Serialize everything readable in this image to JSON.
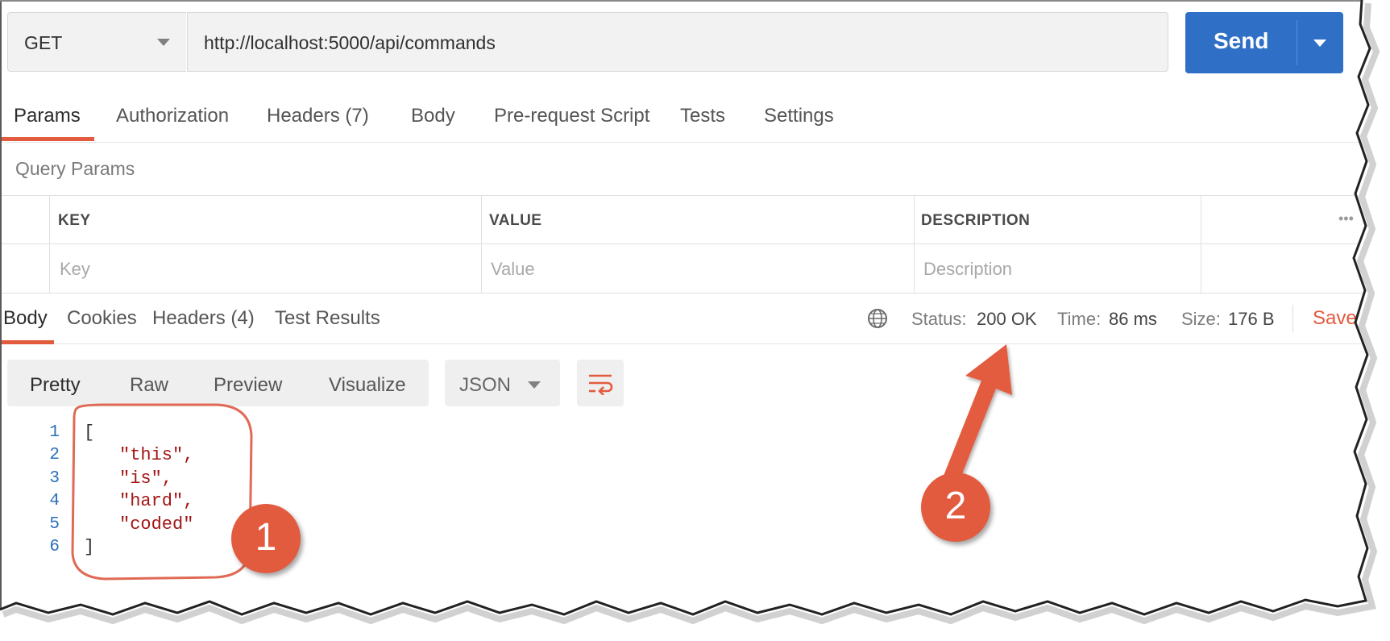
{
  "request": {
    "method": "GET",
    "url": "http://localhost:5000/api/commands",
    "send_label": "Send"
  },
  "request_tabs": [
    {
      "label": "Params",
      "active": true
    },
    {
      "label": "Authorization",
      "active": false
    },
    {
      "label": "Headers (7)",
      "active": false
    },
    {
      "label": "Body",
      "active": false
    },
    {
      "label": "Pre-request Script",
      "active": false
    },
    {
      "label": "Tests",
      "active": false
    },
    {
      "label": "Settings",
      "active": false
    }
  ],
  "query_params": {
    "title": "Query Params",
    "columns": [
      "KEY",
      "VALUE",
      "DESCRIPTION"
    ],
    "placeholders": {
      "key": "Key",
      "value": "Value",
      "description": "Description"
    }
  },
  "response_tabs": [
    {
      "label": "Body",
      "active": true
    },
    {
      "label": "Cookies",
      "active": false
    },
    {
      "label": "Headers (4)",
      "active": false
    },
    {
      "label": "Test Results",
      "active": false
    }
  ],
  "response_meta": {
    "status_label": "Status:",
    "status_value": "200 OK",
    "time_label": "Time:",
    "time_value": "86 ms",
    "size_label": "Size:",
    "size_value": "176 B",
    "save_label": "Save"
  },
  "body_views": [
    {
      "label": "Pretty",
      "active": true
    },
    {
      "label": "Raw",
      "active": false
    },
    {
      "label": "Preview",
      "active": false
    },
    {
      "label": "Visualize",
      "active": false
    }
  ],
  "format": "JSON",
  "code_lines": [
    {
      "num": "1",
      "text": "[",
      "kind": "pun"
    },
    {
      "num": "2",
      "text": "\"this\",",
      "kind": "str"
    },
    {
      "num": "3",
      "text": "\"is\",",
      "kind": "str"
    },
    {
      "num": "4",
      "text": "\"hard\",",
      "kind": "str"
    },
    {
      "num": "5",
      "text": "\"coded\"",
      "kind": "str"
    },
    {
      "num": "6",
      "text": "]",
      "kind": "pun"
    }
  ],
  "annotations": [
    {
      "label": "1"
    },
    {
      "label": "2"
    }
  ],
  "colors": {
    "send_button": "#2f6fc6",
    "accent": "#e35b3f",
    "string_token": "#a31515",
    "line_number": "#2b6fb8"
  },
  "icons": [
    "chevron-down-icon",
    "globe-icon",
    "wrap-lines-icon",
    "more-dots-icon"
  ]
}
